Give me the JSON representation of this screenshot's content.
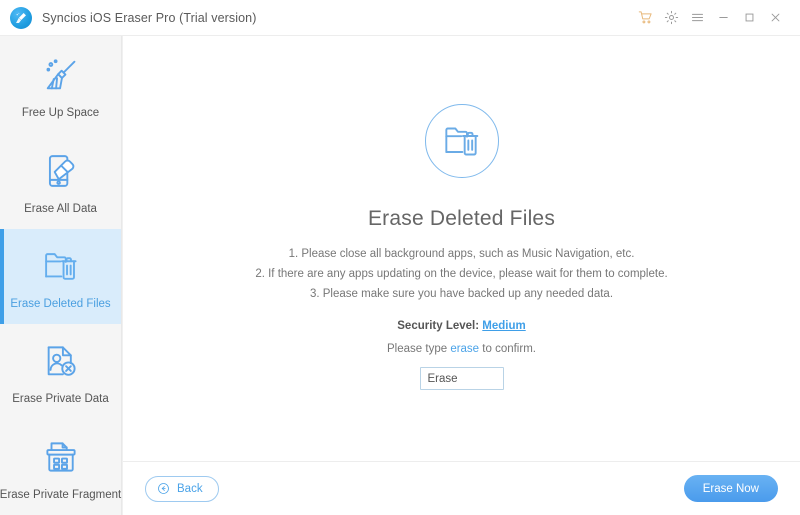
{
  "window": {
    "title": "Syncios iOS Eraser Pro (Trial version)",
    "logo_icon": "broom-logo-icon",
    "controls": [
      {
        "name": "cart-icon",
        "label": "Cart"
      },
      {
        "name": "gear-icon",
        "label": "Settings"
      },
      {
        "name": "menu-icon",
        "label": "Menu"
      },
      {
        "name": "minimize-icon",
        "label": "Minimize"
      },
      {
        "name": "maximize-icon",
        "label": "Maximize"
      },
      {
        "name": "close-icon",
        "label": "Close"
      }
    ]
  },
  "sidebar": {
    "items": [
      {
        "label": "Free Up Space",
        "icon": "broom-icon",
        "active": false
      },
      {
        "label": "Erase All Data",
        "icon": "phone-eraser-icon",
        "active": false
      },
      {
        "label": "Erase Deleted Files",
        "icon": "folder-trash-icon",
        "active": true
      },
      {
        "label": "Erase Private Data",
        "icon": "document-user-remove-icon",
        "active": false
      },
      {
        "label": "Erase Private Fragment",
        "icon": "shredder-icon",
        "active": false
      }
    ]
  },
  "main": {
    "hero_icon": "folder-trash-circle-icon",
    "heading": "Erase Deleted Files",
    "instructions": [
      "1. Please close all background apps, such as Music Navigation, etc.",
      "2. If there are any apps updating on the device, please wait for them to complete.",
      "3. Please make sure you have backed up any needed data."
    ],
    "security": {
      "label": "Security Level:",
      "value": "Medium"
    },
    "confirm": {
      "prefix": "Please type ",
      "keyword": "erase",
      "suffix": " to confirm."
    },
    "input": {
      "value": "Erase",
      "placeholder": ""
    }
  },
  "footer": {
    "back_label": "Back",
    "back_icon": "arrow-left-circle-icon",
    "erase_now_label": "Erase Now"
  },
  "colors": {
    "accent": "#4ba3e8",
    "accent_dark": "#3f9fe8",
    "active_bg": "#d9ecfb",
    "cart": "#e8b87a",
    "sidebar_bg": "#f5f5f5",
    "text": "#777777"
  }
}
